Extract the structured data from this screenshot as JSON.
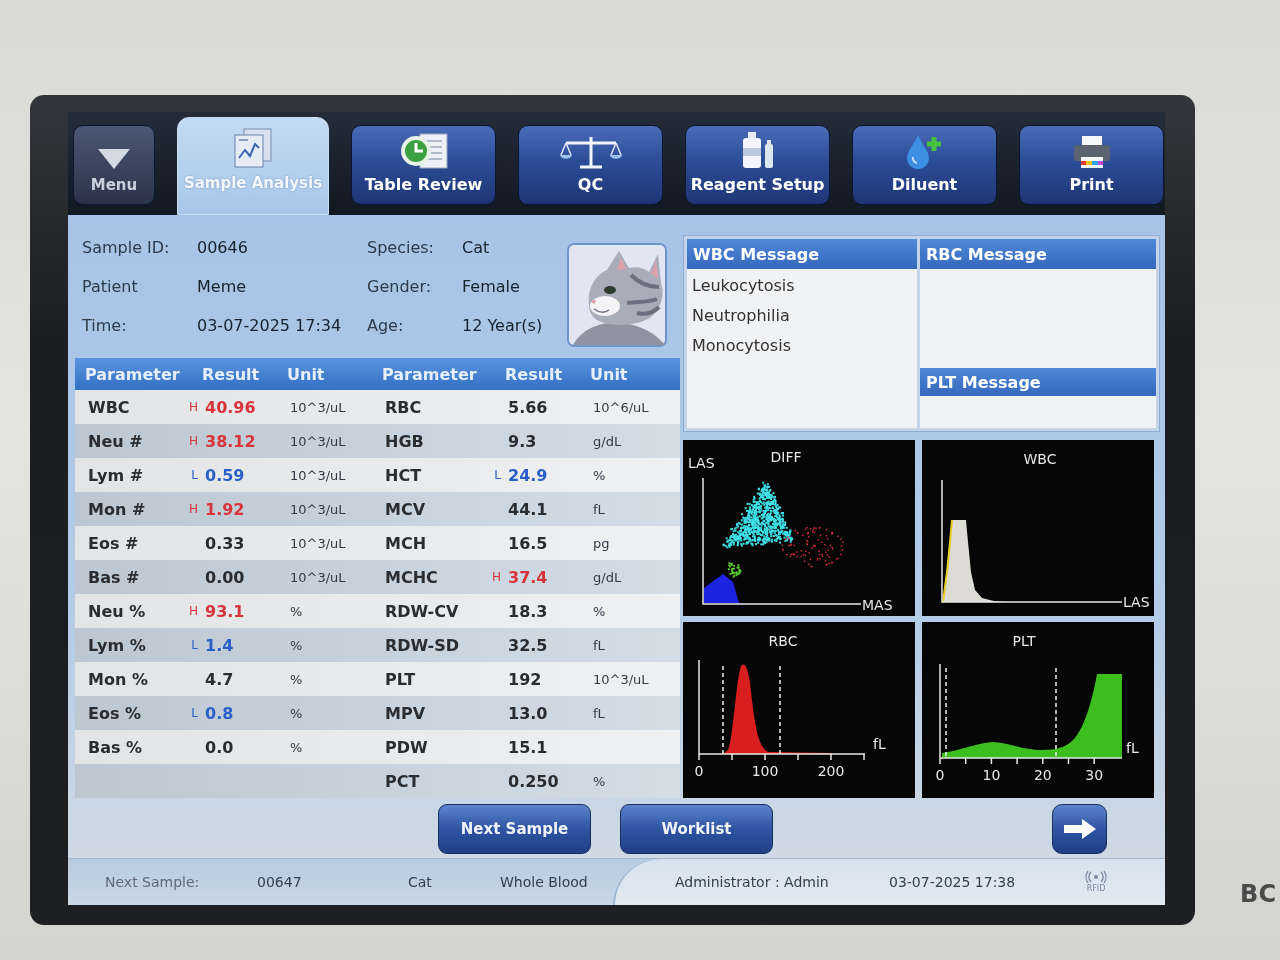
{
  "toolbar": {
    "items": [
      {
        "label": "Menu",
        "kind": "menu",
        "selected": false
      },
      {
        "label": "Sample Analysis",
        "kind": "tab",
        "selected": true
      },
      {
        "label": "Table Review",
        "kind": "tab",
        "selected": false
      },
      {
        "label": "QC",
        "kind": "tab",
        "selected": false
      },
      {
        "label": "Reagent Setup",
        "kind": "tab",
        "selected": false
      },
      {
        "label": "Diluent",
        "kind": "tab",
        "selected": false
      },
      {
        "label": "Print",
        "kind": "tab",
        "selected": false
      }
    ]
  },
  "sample_info": {
    "fields": [
      {
        "label": "Sample ID:",
        "value": "00646"
      },
      {
        "label": "Species:",
        "value": "Cat"
      },
      {
        "label": "Patient",
        "value": "Meme"
      },
      {
        "label": "Gender:",
        "value": "Female"
      },
      {
        "label": "Time:",
        "value": "03-07-2025 17:34"
      },
      {
        "label": "Age:",
        "value": "12 Year(s)"
      }
    ]
  },
  "results_table": {
    "columns": [
      "Parameter",
      "Result",
      "Unit",
      "Parameter",
      "Result",
      "Unit"
    ],
    "rows": [
      {
        "left": {
          "parameter": "WBC",
          "flag": "H",
          "high": true,
          "low": false,
          "result": "40.96",
          "unit": "10^3/uL"
        },
        "right": {
          "parameter": "RBC",
          "high": false,
          "low": false,
          "result": "5.66",
          "unit": "10^6/uL"
        }
      },
      {
        "left": {
          "parameter": "Neu #",
          "flag": "H",
          "high": true,
          "low": false,
          "result": "38.12",
          "unit": "10^3/uL"
        },
        "right": {
          "parameter": "HGB",
          "high": false,
          "low": false,
          "result": "9.3",
          "unit": "g/dL"
        }
      },
      {
        "left": {
          "parameter": "Lym #",
          "flag": "L",
          "high": false,
          "low": true,
          "result": "0.59",
          "unit": "10^3/uL"
        },
        "right": {
          "parameter": "HCT",
          "flag": "L",
          "high": false,
          "low": true,
          "result": "24.9",
          "unit": "%"
        }
      },
      {
        "left": {
          "parameter": "Mon #",
          "flag": "H",
          "high": true,
          "low": false,
          "result": "1.92",
          "unit": "10^3/uL"
        },
        "right": {
          "parameter": "MCV",
          "high": false,
          "low": false,
          "result": "44.1",
          "unit": "fL"
        }
      },
      {
        "left": {
          "parameter": "Eos #",
          "high": false,
          "low": false,
          "result": "0.33",
          "unit": "10^3/uL"
        },
        "right": {
          "parameter": "MCH",
          "high": false,
          "low": false,
          "result": "16.5",
          "unit": "pg"
        }
      },
      {
        "left": {
          "parameter": "Bas #",
          "high": false,
          "low": false,
          "result": "0.00",
          "unit": "10^3/uL"
        },
        "right": {
          "parameter": "MCHC",
          "flag": "H",
          "high": true,
          "low": false,
          "result": "37.4",
          "unit": "g/dL"
        }
      },
      {
        "left": {
          "parameter": "Neu %",
          "flag": "H",
          "high": true,
          "low": false,
          "result": "93.1",
          "unit": "%"
        },
        "right": {
          "parameter": "RDW-CV",
          "high": false,
          "low": false,
          "result": "18.3",
          "unit": "%"
        }
      },
      {
        "left": {
          "parameter": "Lym %",
          "flag": "L",
          "high": false,
          "low": true,
          "result": "1.4",
          "unit": "%"
        },
        "right": {
          "parameter": "RDW-SD",
          "high": false,
          "low": false,
          "result": "32.5",
          "unit": "fL"
        }
      },
      {
        "left": {
          "parameter": "Mon %",
          "high": false,
          "low": false,
          "result": "4.7",
          "unit": "%"
        },
        "right": {
          "parameter": "PLT",
          "high": false,
          "low": false,
          "result": "192",
          "unit": "10^3/uL"
        }
      },
      {
        "left": {
          "parameter": "Eos %",
          "flag": "L",
          "high": false,
          "low": true,
          "result": "0.8",
          "unit": "%"
        },
        "right": {
          "parameter": "MPV",
          "high": false,
          "low": false,
          "result": "13.0",
          "unit": "fL"
        }
      },
      {
        "left": {
          "parameter": "Bas %",
          "high": false,
          "low": false,
          "result": "0.0",
          "unit": "%"
        },
        "right": {
          "parameter": "PDW",
          "high": false,
          "low": false,
          "result": "15.1"
        }
      },
      {
        "right": {
          "parameter": "PCT",
          "high": false,
          "low": false,
          "result": "0.250",
          "unit": "%"
        }
      }
    ]
  },
  "wbc_message": {
    "title": "WBC Message",
    "items": [
      "Leukocytosis",
      "Neutrophilia",
      "Monocytosis"
    ]
  },
  "rbc_message": {
    "title": "RBC Message"
  },
  "plt_message": {
    "title": "PLT Message"
  },
  "charts": [
    {
      "kind": "scatter",
      "title": "DIFF",
      "y_label": "LAS",
      "x_label": "MAS"
    },
    {
      "kind": "histogram",
      "title": "WBC",
      "x_label": "LAS"
    },
    {
      "kind": "histogram",
      "title": "RBC",
      "tick_labels": [
        "0",
        "100",
        "200"
      ],
      "unit": "fL"
    },
    {
      "kind": "histogram",
      "title": "PLT",
      "tick_labels": [
        "0",
        "10",
        "20",
        "30"
      ],
      "unit": "fL"
    }
  ],
  "buttons": [
    "Next Sample",
    "Worklist"
  ],
  "status_bar": {
    "next_sample_label": "Next Sample:",
    "next_sample_id": "00647",
    "species": "Cat",
    "sample_type": "Whole Blood",
    "user": "Administrator : Admin",
    "datetime": "03-07-2025 17:38",
    "rfid_label": "RFID"
  },
  "device": {
    "label": "BC"
  }
}
